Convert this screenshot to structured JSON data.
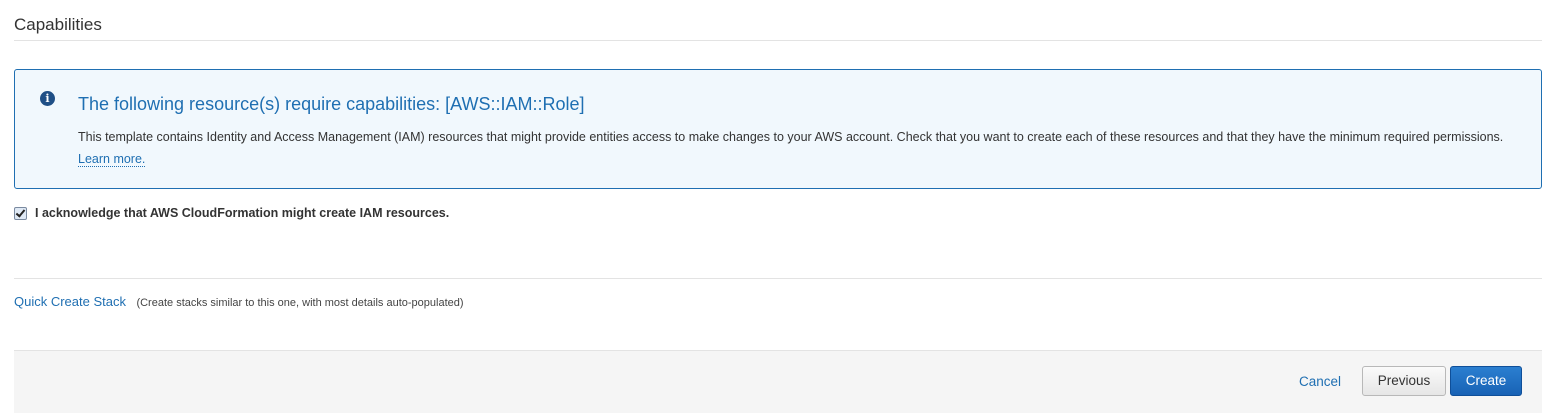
{
  "section": {
    "title": "Capabilities"
  },
  "info_alert": {
    "icon": "info-icon",
    "icon_glyph": "i",
    "heading": "The following resource(s) require capabilities: [AWS::IAM::Role]",
    "body": "This template contains Identity and Access Management (IAM) resources that might provide entities access to make changes to your AWS account. Check that you want to create each of these resources and that they have the minimum required permissions.",
    "link_label": "Learn more."
  },
  "acknowledgement": {
    "checked": true,
    "label": "I acknowledge that AWS CloudFormation might create IAM resources."
  },
  "quick_create": {
    "link_label": "Quick Create Stack",
    "note": "(Create stacks similar to this one, with most details auto-populated)"
  },
  "footer": {
    "cancel_label": "Cancel",
    "previous_label": "Previous",
    "create_label": "Create"
  },
  "colors": {
    "accent": "#1f6fb2",
    "primary_button": "#1862b5",
    "info_background": "#f1f8fd"
  }
}
